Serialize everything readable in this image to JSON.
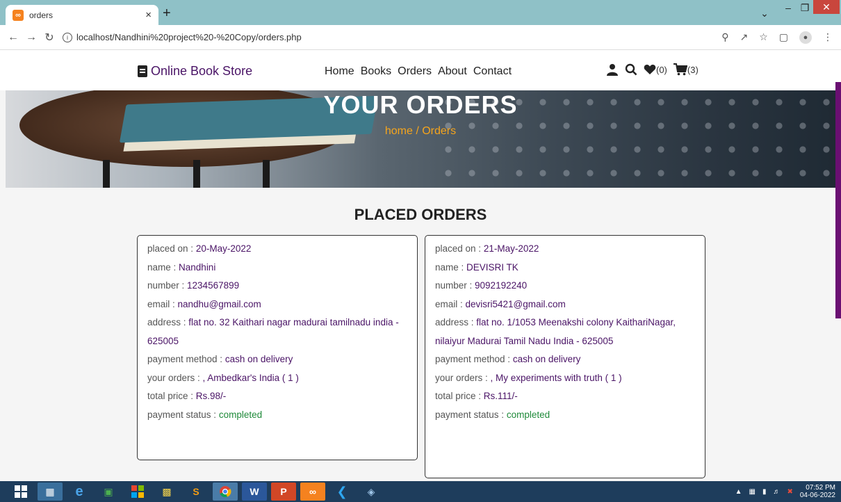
{
  "browser": {
    "tab_title": "orders",
    "tab_close": "×",
    "new_tab": "+",
    "url": "localhost/Nandhini%20project%20-%20Copy/orders.php"
  },
  "site": {
    "logo_text": "Online Book Store",
    "nav": [
      "Home",
      "Books",
      "Orders",
      "About",
      "Contact"
    ],
    "wishlist_count": "(0)",
    "cart_count": "(3)"
  },
  "hero": {
    "title": "YOUR ORDERS",
    "breadcrumb": "home / Orders"
  },
  "section_title": "PLACED ORDERS",
  "orders": [
    {
      "placed_on_label": "placed on : ",
      "placed_on": "20-May-2022",
      "name_label": "name : ",
      "name": "Nandhini",
      "number_label": "number : ",
      "number": "1234567899",
      "email_label": "email : ",
      "email": "nandhu@gmail.com",
      "address_label": "address : ",
      "address": "flat no. 32 Kaithari nagar madurai tamilnadu india - 625005",
      "payment_method_label": "payment method : ",
      "payment_method": "cash on delivery",
      "your_orders_label": "your orders : ",
      "your_orders": ", Ambedkar's India ( 1 )",
      "total_price_label": "total price : ",
      "total_price": "Rs.98/-",
      "payment_status_label": "payment status : ",
      "payment_status": "completed"
    },
    {
      "placed_on_label": "placed on : ",
      "placed_on": "21-May-2022",
      "name_label": "name : ",
      "name": "DEVISRI TK",
      "number_label": "number : ",
      "number": "9092192240",
      "email_label": "email : ",
      "email": "devisri5421@gmail.com",
      "address_label": "address : ",
      "address": "flat no. 1/1053 Meenakshi colony KaithariNagar, nilaiyur Madurai Tamil Nadu India - 625005",
      "payment_method_label": "payment method : ",
      "payment_method": "cash on delivery",
      "your_orders_label": "your orders : ",
      "your_orders": ", My experiments with truth ( 1 )",
      "total_price_label": "total price : ",
      "total_price": "Rs.111/-",
      "payment_status_label": "payment status : ",
      "payment_status": "completed"
    }
  ],
  "taskbar": {
    "time": "07:52 PM",
    "date": "04-06-2022"
  },
  "colors": {
    "brand": "#4a1466",
    "accent": "#f6a51c",
    "status_ok": "#1f8a3a",
    "tabbar": "#8fc1c7"
  }
}
